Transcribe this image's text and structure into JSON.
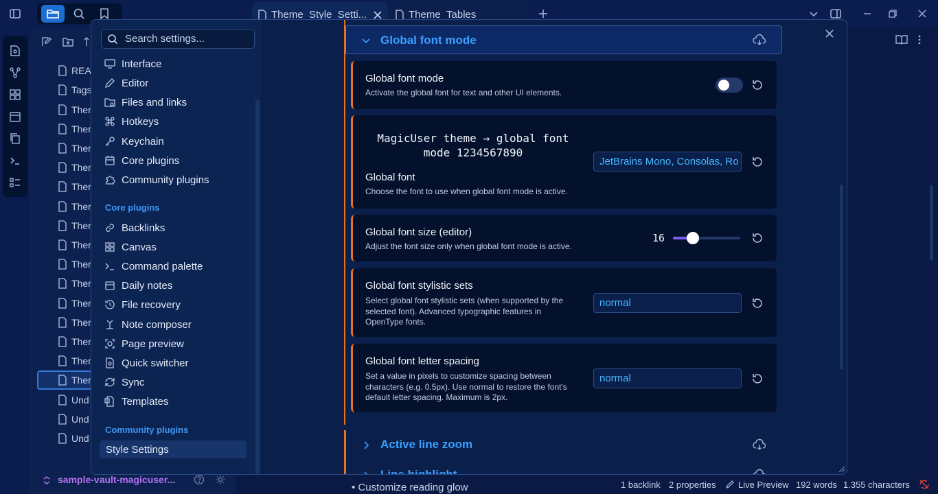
{
  "tabs": [
    {
      "label": "Theme_Style_Setti..."
    },
    {
      "label": "Theme_Tables"
    }
  ],
  "explorer": {
    "files": [
      "READ",
      "Tags",
      "Ther",
      "Ther",
      "Ther",
      "Ther",
      "Ther",
      "Ther",
      "Ther",
      "Ther",
      "Ther",
      "Ther",
      "Ther",
      "Ther",
      "Ther",
      "Ther",
      "Ther",
      "Und",
      "Und",
      "Und"
    ],
    "vault_name": "sample-vault-magicuser..."
  },
  "editor": {
    "bullet_text": "Customize reading glow"
  },
  "status": {
    "backlinks": "1 backlink",
    "properties": "2 properties",
    "mode": "Live Preview",
    "words": "192 words",
    "characters": "1.355 characters"
  },
  "settings": {
    "search_placeholder": "Search settings...",
    "options": [
      {
        "label": "Interface",
        "icon": "monitor-icon"
      },
      {
        "label": "Editor",
        "icon": "pencil-icon"
      },
      {
        "label": "Files and links",
        "icon": "folder-link-icon"
      },
      {
        "label": "Hotkeys",
        "icon": "command-icon"
      },
      {
        "label": "Keychain",
        "icon": "key-icon"
      },
      {
        "label": "Core plugins",
        "icon": "calendar-plug-icon"
      },
      {
        "label": "Community plugins",
        "icon": "puzzle-icon"
      }
    ],
    "core_header": "Core plugins",
    "core_plugins": [
      {
        "label": "Backlinks",
        "icon": "link-icon"
      },
      {
        "label": "Canvas",
        "icon": "grid-icon"
      },
      {
        "label": "Command palette",
        "icon": "terminal-icon"
      },
      {
        "label": "Daily notes",
        "icon": "calendar-icon"
      },
      {
        "label": "File recovery",
        "icon": "history-icon"
      },
      {
        "label": "Note composer",
        "icon": "merge-icon"
      },
      {
        "label": "Page preview",
        "icon": "preview-icon"
      },
      {
        "label": "Quick switcher",
        "icon": "file-search-icon"
      },
      {
        "label": "Sync",
        "icon": "sync-icon"
      },
      {
        "label": "Templates",
        "icon": "template-icon"
      }
    ],
    "community_header": "Community plugins",
    "community_plugins": [
      {
        "label": "Style Settings",
        "active": true
      }
    ]
  },
  "section": {
    "title": "Global font mode",
    "items": {
      "mode": {
        "title": "Global font mode",
        "desc": "Activate the global font for text and other UI elements.",
        "enabled": false
      },
      "font": {
        "preview_line1": "MagicUser theme → global font",
        "preview_line2": "mode 1234567890",
        "title": "Global font",
        "desc": "Choose the font to use when global font mode is active.",
        "value": "JetBrains Mono, Consolas, Ro"
      },
      "size": {
        "title": "Global font size (editor)",
        "desc": "Adjust the font size only when global font mode is active.",
        "value": "16",
        "min": 10,
        "max": 30
      },
      "stylistic": {
        "title": "Global font stylistic sets",
        "desc1": "Select global font stylistic sets (when supported by the",
        "desc2": "selected font). Advanced typographic features in",
        "desc3": "OpenType fonts.",
        "value": "normal"
      },
      "spacing": {
        "title": "Global font letter spacing",
        "desc1": "Set a value in pixels to customize spacing between",
        "desc2": "characters (e.g. 0.5px). Use normal to restore the font's",
        "desc3": "default letter spacing. Maximum is 2px.",
        "value": "normal"
      }
    }
  },
  "next_sections": [
    {
      "title": "Active line zoom"
    },
    {
      "title": "Line highlight"
    }
  ],
  "colors": {
    "accent": "#3aa0ff",
    "card_border": "#e9731d",
    "slider": "#7c5cf0",
    "vault": "#b470f0"
  }
}
